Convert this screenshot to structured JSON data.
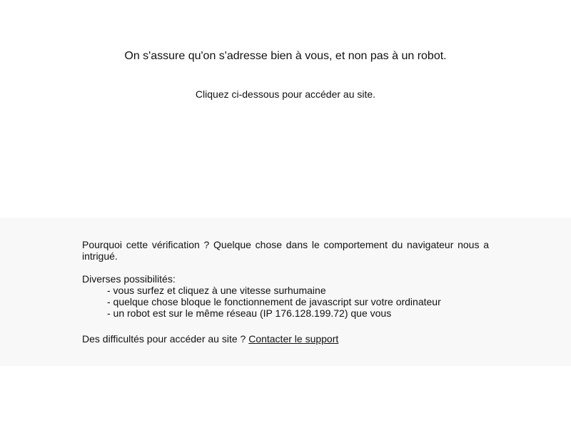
{
  "header": {
    "headline": "On s'assure qu'on s'adresse bien à vous, et non pas à un robot.",
    "instruction": "Cliquez ci-dessous pour accéder au site."
  },
  "info": {
    "why_text": "Pourquoi cette vérification ? Quelque chose dans le comportement du navigateur nous a intrigué.",
    "possibilities_title": "Diverses possibilités:",
    "possibilities": [
      "- vous surfez et cliquez à une vitesse surhumaine",
      "- quelque chose bloque le fonctionnement de javascript sur votre ordinateur",
      "- un robot est sur le même réseau (IP 176.128.199.72) que vous"
    ],
    "support_text": "Des difficultés pour accéder au site ? ",
    "support_link_label": "Contacter le support"
  }
}
